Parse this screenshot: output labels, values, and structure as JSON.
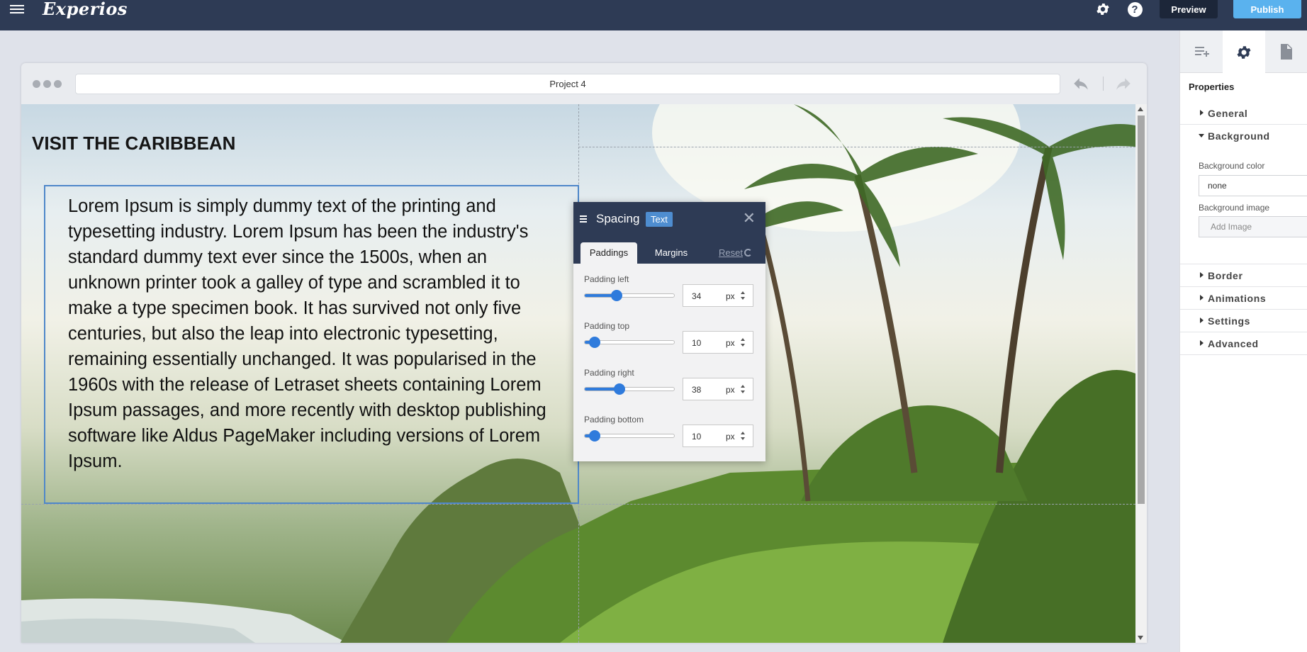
{
  "app": {
    "logo": "Experios",
    "preview_label": "Preview",
    "publish_label": "Publish"
  },
  "browser": {
    "url_title": "Project 4"
  },
  "page": {
    "heading": "VISIT THE CARIBBEAN",
    "body_text": "Lorem Ipsum is simply dummy text of the printing and typesetting industry. Lorem Ipsum has been the industry's standard dummy text ever since the 1500s, when an unknown printer took a galley of type and scrambled it to make a type specimen book. It has survived not only five centuries, but also the leap into electronic typesetting, remaining essentially unchanged. It was popularised in the 1960s with the release of Letraset sheets containing Lorem Ipsum passages, and more recently with desktop publishing software like Aldus PageMaker including versions of Lorem Ipsum."
  },
  "spacing_popup": {
    "title": "Spacing",
    "badge": "Text",
    "tabs": [
      "Paddings",
      "Margins"
    ],
    "active_tab": "Paddings",
    "reset_label": "Reset",
    "fields": [
      {
        "label": "Padding left",
        "value": "34",
        "unit": "px",
        "slider_fraction": 0.36
      },
      {
        "label": "Padding top",
        "value": "10",
        "unit": "px",
        "slider_fraction": 0.11
      },
      {
        "label": "Padding right",
        "value": "38",
        "unit": "px",
        "slider_fraction": 0.39
      },
      {
        "label": "Padding bottom",
        "value": "10",
        "unit": "px",
        "slider_fraction": 0.11
      }
    ]
  },
  "sidebar": {
    "tab_icons": [
      "add-element-icon",
      "gear-icon",
      "page-icon"
    ],
    "title": "Properties",
    "sections": [
      {
        "label": "General",
        "open": false
      },
      {
        "label": "Background",
        "open": true
      },
      {
        "label": "Border",
        "open": false
      },
      {
        "label": "Animations",
        "open": false
      },
      {
        "label": "Settings",
        "open": false
      },
      {
        "label": "Advanced",
        "open": false
      }
    ],
    "background": {
      "color_label": "Background color",
      "color_value": "none",
      "image_label": "Background image",
      "image_placeholder": "Add Image"
    }
  },
  "colors": {
    "topbar": "#2e3b55",
    "publish": "#5ab2ee",
    "selection": "#4e87c9",
    "slider": "#2f7bdc"
  }
}
